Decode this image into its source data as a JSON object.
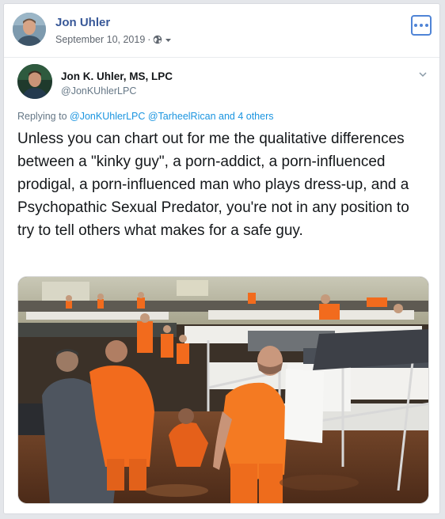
{
  "post": {
    "author": "Jon Uhler",
    "date": "September 10, 2019",
    "separator": "·",
    "privacy_icon": "globe-icon",
    "more_icon": "ellipsis-icon"
  },
  "tweet": {
    "name": "Jon K. Uhler, MS, LPC",
    "handle": "@JonKUhlerLPC",
    "reply_prefix": "Replying to",
    "reply_mentions": "@JonKUhlerLPC @TarheelRican and 4 others",
    "text": "Unless you can chart out for me the qualitative differences between a \"kinky guy\", a porn-addict, a porn-influenced prodigal, a porn-influenced man who plays dress-up, and a Psychopathic Sexual Predator, you're not in any position to try to tell others what makes for a safe guy.",
    "photo_description": "Crowded prison gym with bunk beds and inmates in orange clothing"
  },
  "colors": {
    "link_blue": "#385898",
    "twitter_blue": "#1b95e0",
    "inmate_orange": "#f26b1d"
  }
}
